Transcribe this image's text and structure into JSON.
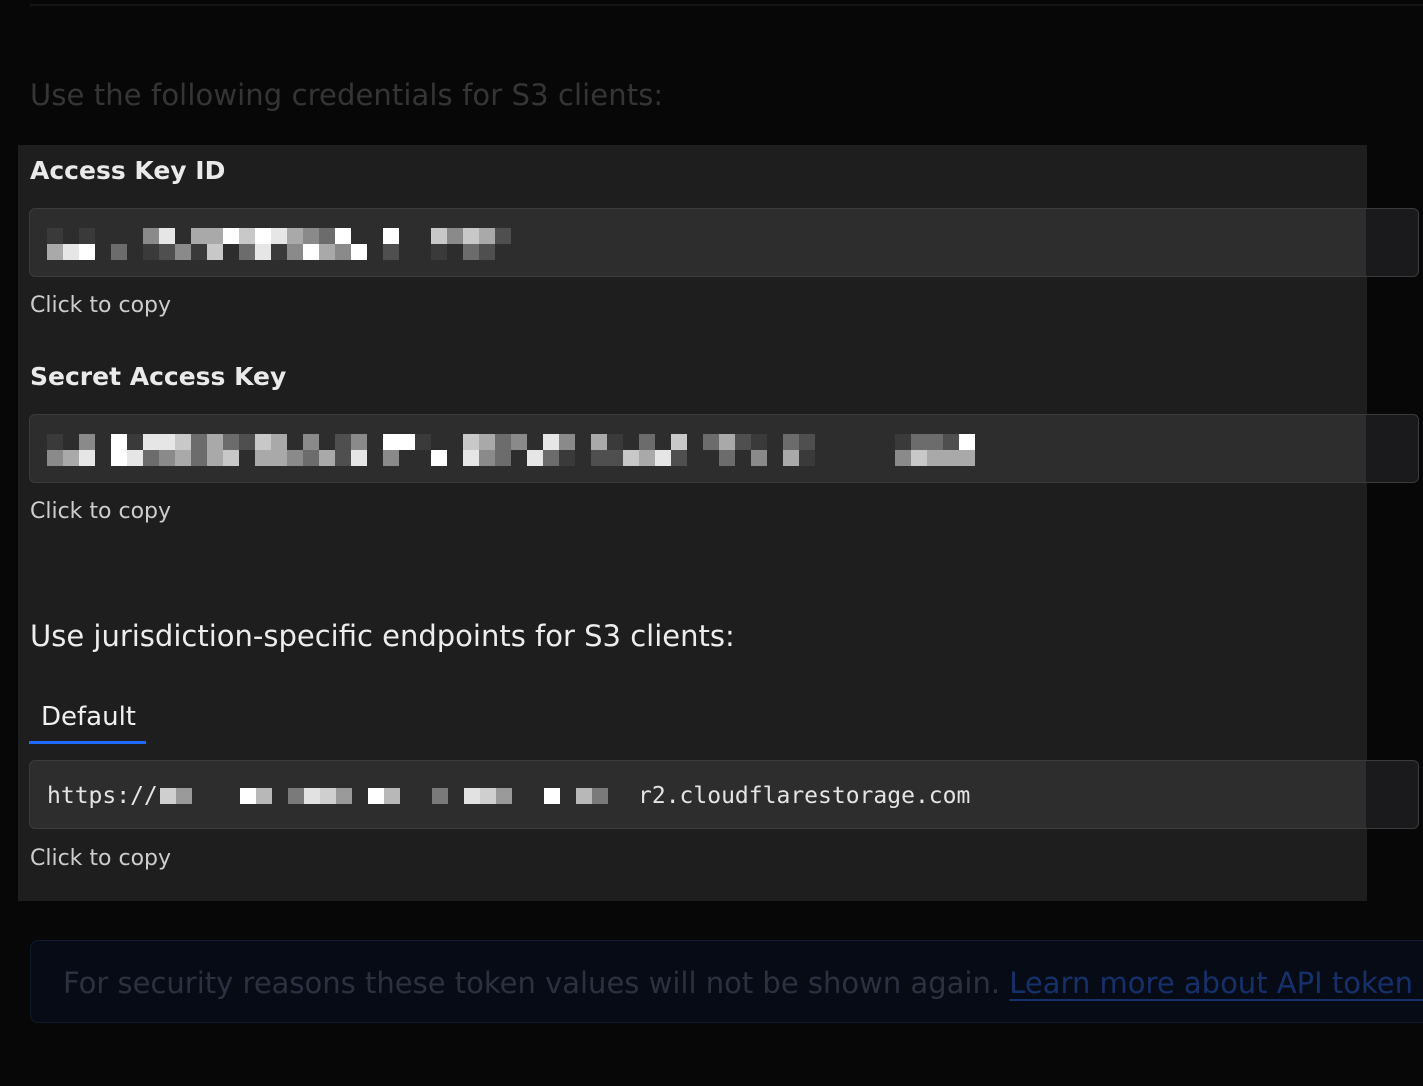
{
  "page": {
    "intro_heading": "Use the following credentials for S3 clients:"
  },
  "credentials": {
    "access_key": {
      "label": "Access Key ID",
      "copy_hint": "Click to copy"
    },
    "secret_key": {
      "label": "Secret Access Key",
      "copy_hint": "Click to copy"
    }
  },
  "endpoints": {
    "heading": "Use jurisdiction-specific endpoints for S3 clients:",
    "tabs": [
      {
        "label": "Default",
        "active": true
      }
    ],
    "url_prefix": "https://",
    "url_suffix": "r2.cloudflarestorage.com",
    "copy_hint": "Click to copy"
  },
  "notice": {
    "text": "For security reasons these token values will not be shown again.",
    "link_text": "Learn more about API token g"
  },
  "colors": {
    "accent": "#1f6bff",
    "panel_bg": "#1e1e1e",
    "field_bg": "#2d2d2d"
  }
}
